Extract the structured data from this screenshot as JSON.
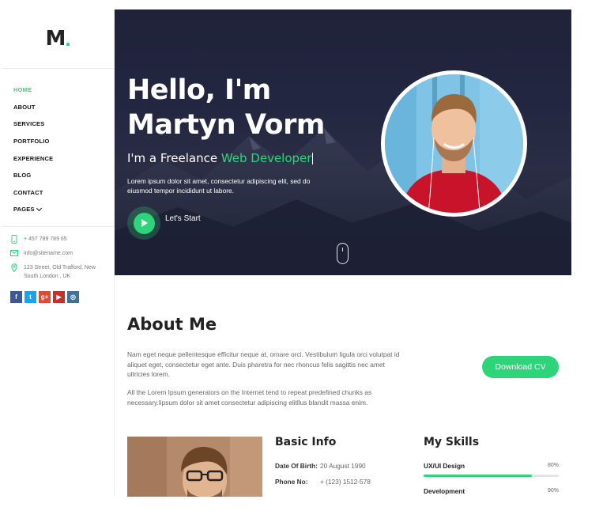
{
  "logo": {
    "letter": "M",
    "dot": "."
  },
  "nav": {
    "items": [
      {
        "label": "HOME",
        "active": true
      },
      {
        "label": "ABOUT"
      },
      {
        "label": "SERVICES"
      },
      {
        "label": "PORTFOLIO"
      },
      {
        "label": "EXPERIENCE"
      },
      {
        "label": "BLOG"
      },
      {
        "label": "CONTACT"
      },
      {
        "label": "PAGES"
      }
    ]
  },
  "contacts": {
    "phone": "+ 457 789 789 65",
    "email": "info@sitename.com",
    "address": "123 Street, Old Trafford, New South London , UK"
  },
  "socials": [
    {
      "name": "facebook",
      "glyph": "f",
      "color": "#3b5998"
    },
    {
      "name": "twitter",
      "glyph": "t",
      "color": "#1da1f2"
    },
    {
      "name": "google-plus",
      "glyph": "g+",
      "color": "#dd4b39"
    },
    {
      "name": "youtube",
      "glyph": "▶",
      "color": "#c4302b"
    },
    {
      "name": "instagram",
      "glyph": "◎",
      "color": "#3f729b"
    }
  ],
  "hero": {
    "title_line1": "Hello, I'm",
    "title_line2": "Martyn Vorm",
    "subtitle_prefix": "I'm a Freelance ",
    "subtitle_highlight": "Web Developer",
    "description": "Lorem ipsum dolor sit amet, consectetur adipiscing elit, sed do eiusmod tempor incididunt ut labore.",
    "cta_label": "Let's Start"
  },
  "about": {
    "title": "About Me",
    "paragraph1": "Nam eget neque pellentesque efficitur neque at, ornare orci. Vestibulum ligula orci volutpat id aliquet eget, consectetur eget ante. Duis pharetra for nec rhoncus felis sagittis nec amet ultricies lorem.",
    "paragraph2": "All the Lorem Ipsum generators on the Internet tend to repeat predefined chunks as necessary.lipsum dolor sit amet consectetur adipiscing elitllus blandit massa enim.",
    "cv_button": "Download CV"
  },
  "basic_info": {
    "title": "Basic Info",
    "rows": [
      {
        "key": "Date Of Birth:",
        "value": "20 August 1990"
      },
      {
        "key": "Phone No:",
        "value": "+ (123) 1512-578"
      }
    ]
  },
  "skills": {
    "title": "My Skills",
    "items": [
      {
        "name": "UX/UI Design",
        "percent_label": "80%",
        "level": 0.8
      },
      {
        "name": "Development",
        "percent_label": "90%",
        "level": 0.9
      }
    ]
  },
  "colors": {
    "accent": "#2ed47a",
    "hero_bg": "#232640"
  }
}
